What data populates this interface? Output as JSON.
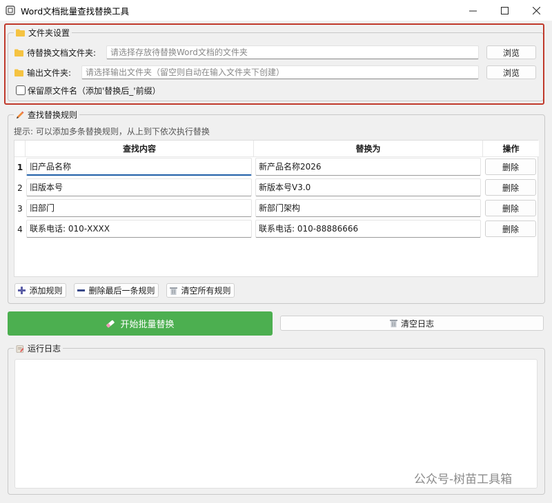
{
  "window": {
    "title": "Word文档批量查找替换工具",
    "minimize": "—",
    "maximize": "☐",
    "close": "✕"
  },
  "folder_settings": {
    "group_title": "文件夹设置",
    "source_label": "待替换文档文件夹:",
    "source_placeholder": "请选择存放待替换Word文档的文件夹",
    "output_label": "输出文件夹:",
    "output_placeholder": "请选择输出文件夹（留空则自动在输入文件夹下创建）",
    "browse_label": "浏览",
    "keep_name_label": "保留原文件名（添加'替换后_'前缀）",
    "keep_name_checked": false
  },
  "rules": {
    "group_title": "查找替换规则",
    "hint": "提示: 可以添加多条替换规则，从上到下依次执行替换",
    "columns": [
      "查找内容",
      "替换为",
      "操作"
    ],
    "rows": [
      {
        "num": "1",
        "find": "旧产品名称",
        "replace": "新产品名称2026",
        "action": "删除"
      },
      {
        "num": "2",
        "find": "旧版本号",
        "replace": "新版本号V3.0",
        "action": "删除"
      },
      {
        "num": "3",
        "find": "旧部门",
        "replace": "新部门架构",
        "action": "删除"
      },
      {
        "num": "4",
        "find": "联系电话: 010-XXXX",
        "replace": "联系电话: 010-88886666",
        "action": "删除"
      }
    ],
    "add_label": "添加规则",
    "remove_last_label": "删除最后一条规则",
    "clear_all_label": "清空所有规则"
  },
  "actions": {
    "start_label": "开始批量替换",
    "start_color": "#4caf50",
    "clear_log_label": "清空日志"
  },
  "log": {
    "group_title": "运行日志"
  },
  "watermark": "公众号-树苗工具箱"
}
